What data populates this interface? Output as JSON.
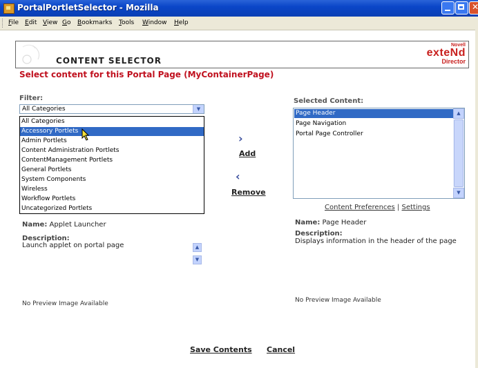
{
  "window": {
    "title": "PortalPortletSelector - Mozilla"
  },
  "menu": {
    "items": [
      "File",
      "Edit",
      "View",
      "Go",
      "Bookmarks",
      "Tools",
      "Window",
      "Help"
    ]
  },
  "header": {
    "title": "CONTENT SELECTOR",
    "brand_small": "Novell",
    "brand_big": "exteNd",
    "brand_sub": "Director"
  },
  "page": {
    "heading": "Select content for this Portal Page (MyContainerPage)"
  },
  "filter": {
    "label": "Filter:",
    "selected": "All Categories",
    "options": [
      "All Categories",
      "Accessory Portlets",
      "Admin Portlets",
      "Content Administration Portlets",
      "ContentManagement Portlets",
      "General Portlets",
      "System Components",
      "Wireless",
      "Workflow Portlets",
      "Uncategorized Portlets"
    ],
    "highlighted": "Accessory Portlets"
  },
  "actions": {
    "add_label": "Add",
    "remove_label": "Remove"
  },
  "selected_content": {
    "label": "Selected Content:",
    "items": [
      "Page Header",
      "Page Navigation",
      "Portal Page Controller"
    ],
    "highlighted": "Page Header"
  },
  "pref_links": {
    "content_preferences": "Content Preferences",
    "separator": "|",
    "settings": "Settings"
  },
  "left_detail": {
    "name_label": "Name:",
    "name_value": "Applet Launcher",
    "desc_label": "Description:",
    "desc_value": "Launch applet on portal page",
    "preview": "No Preview Image Available"
  },
  "right_detail": {
    "name_label": "Name:",
    "name_value": "Page Header",
    "desc_label": "Description:",
    "desc_value": "Displays information in the header of the page",
    "preview": "No Preview Image Available"
  },
  "bottom": {
    "save_label": "Save Contents",
    "cancel_label": "Cancel"
  },
  "colors": {
    "heading_red": "#c0111f",
    "selection_blue": "#316ac5",
    "titlebar_blue": "#0a46c8"
  }
}
